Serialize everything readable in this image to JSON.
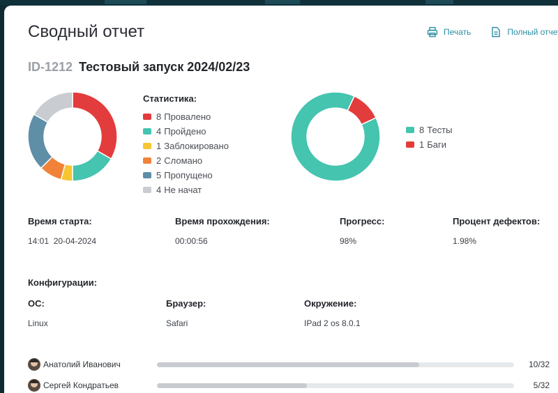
{
  "colors": {
    "failed": "#e23c3c",
    "passed": "#45c4b0",
    "blocked": "#f6c532",
    "broken": "#f0823a",
    "skipped": "#5f8ea7",
    "not_started": "#c9ccd0",
    "accent": "#2a8fa3"
  },
  "header": {
    "title": "Сводный отчет",
    "print_label": "Печать",
    "full_report_label": "Полный отчет"
  },
  "run": {
    "id": "ID-1212",
    "name": "Тестовый запуск 2024/02/23"
  },
  "stats": {
    "title": "Статистика:",
    "items": [
      {
        "count": "8",
        "label": "Провалено",
        "color": "#e23c3c"
      },
      {
        "count": "4",
        "label": "Пройдено",
        "color": "#45c4b0"
      },
      {
        "count": "1",
        "label": "Заблокировано",
        "color": "#f6c532"
      },
      {
        "count": "2",
        "label": "Сломано",
        "color": "#f0823a"
      },
      {
        "count": "5",
        "label": "Пропущено",
        "color": "#5f8ea7"
      },
      {
        "count": "4",
        "label": "Не начат",
        "color": "#c9ccd0"
      }
    ]
  },
  "defects": {
    "items": [
      {
        "count": "8",
        "label": "Тесты",
        "color": "#45c4b0"
      },
      {
        "count": "1",
        "label": "Баги",
        "color": "#e23c3c"
      }
    ]
  },
  "chart_data": [
    {
      "type": "pie",
      "categories": [
        "Провалено",
        "Пройдено",
        "Заблокировано",
        "Сломано",
        "Пропущено",
        "Не начат"
      ],
      "values": [
        8,
        4,
        1,
        2,
        5,
        4
      ],
      "colors": [
        "#e23c3c",
        "#45c4b0",
        "#f6c532",
        "#f0823a",
        "#5f8ea7",
        "#c9ccd0"
      ]
    },
    {
      "type": "pie",
      "categories": [
        "Тесты",
        "Баги"
      ],
      "values": [
        8,
        1
      ],
      "colors": [
        "#45c4b0",
        "#e23c3c"
      ]
    }
  ],
  "metrics": {
    "start": {
      "label": "Время старта:",
      "value": "14:01  20-04-2024"
    },
    "duration": {
      "label": "Время прохождения:",
      "value": "00:00:56"
    },
    "progress": {
      "label": "Прогресс:",
      "value": "98%"
    },
    "defect_rate": {
      "label": "Процент дефектов:",
      "value": "1.98%"
    }
  },
  "config": {
    "title": "Конфигурации:",
    "os": {
      "label": "ОС:",
      "value": "Linux"
    },
    "browser": {
      "label": "Браузер:",
      "value": "Safari"
    },
    "env": {
      "label": "Окружение:",
      "value": "IPad 2 os 8.0.1"
    }
  },
  "people": [
    {
      "name": "Анатолий Иванович",
      "count": "10/32",
      "progress": 0.735
    },
    {
      "name": "Сергей Кондратьев",
      "count": "5/32",
      "progress": 0.42
    }
  ]
}
